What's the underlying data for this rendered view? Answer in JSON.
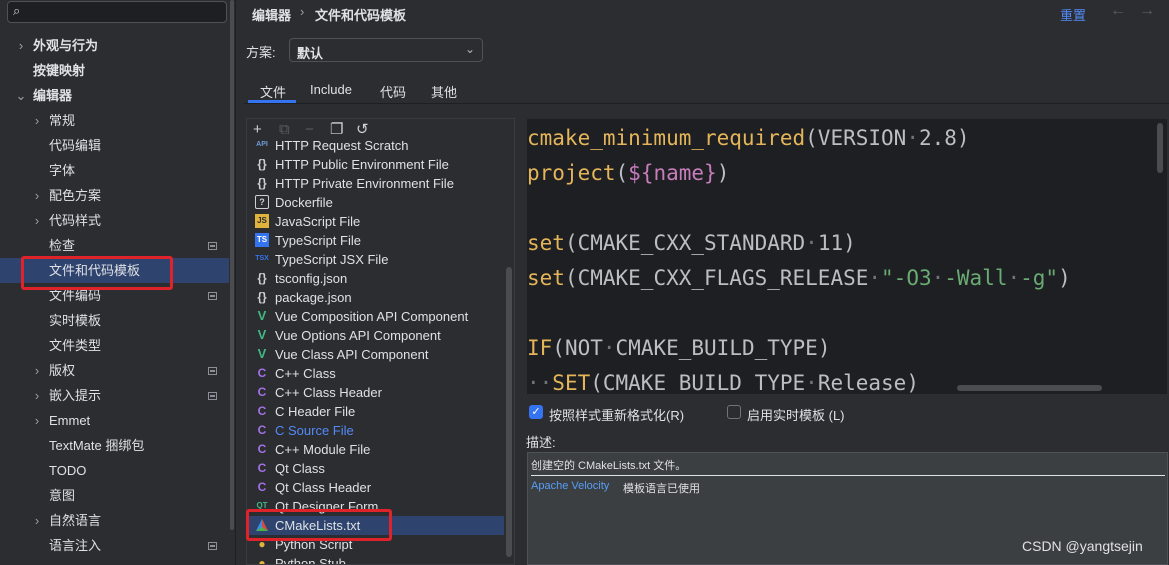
{
  "search": {
    "placeholder": "",
    "icon": "search-icon"
  },
  "sidebar": {
    "items": [
      {
        "label": "外观与行为",
        "chevron": "›",
        "bold": true
      },
      {
        "label": "按键映射",
        "chevron": "",
        "bold": true
      },
      {
        "label": "编辑器",
        "chevron": "⌄",
        "bold": true
      },
      {
        "label": "常规",
        "chevron": "›"
      },
      {
        "label": "代码编辑",
        "chevron": ""
      },
      {
        "label": "字体",
        "chevron": ""
      },
      {
        "label": "配色方案",
        "chevron": "›"
      },
      {
        "label": "代码样式",
        "chevron": "›"
      },
      {
        "label": "检查",
        "chevron": "",
        "mark": true
      },
      {
        "label": "文件和代码模板",
        "chevron": "",
        "selected": true
      },
      {
        "label": "文件编码",
        "chevron": "",
        "mark": true
      },
      {
        "label": "实时模板",
        "chevron": ""
      },
      {
        "label": "文件类型",
        "chevron": ""
      },
      {
        "label": "版权",
        "chevron": "›",
        "mark": true
      },
      {
        "label": "嵌入提示",
        "chevron": "›",
        "mark": true
      },
      {
        "label": "Emmet",
        "chevron": "›"
      },
      {
        "label": "TextMate 捆绑包",
        "chevron": ""
      },
      {
        "label": "TODO",
        "chevron": ""
      },
      {
        "label": "意图",
        "chevron": ""
      },
      {
        "label": "自然语言",
        "chevron": "›"
      },
      {
        "label": "语言注入",
        "chevron": "",
        "mark": true
      }
    ]
  },
  "header": {
    "breadcrumb_parent": "编辑器",
    "breadcrumb_sep": "›",
    "breadcrumb_current": "文件和代码模板",
    "reset_label": "重置",
    "back_icon": "←",
    "forward_icon": "→"
  },
  "scheme": {
    "label": "方案:",
    "value": "默认",
    "dropdown_icon": "⌄"
  },
  "tabs": [
    {
      "label": "文件",
      "active": true
    },
    {
      "label": "Include"
    },
    {
      "label": "代码"
    },
    {
      "label": "其他"
    }
  ],
  "toolbar": {
    "add_icon": "+",
    "copy_icon": "⧉",
    "remove_icon": "−",
    "duplicate_icon": "❐",
    "revert_icon": "↺"
  },
  "templates": [
    {
      "name": "HTTP Request Scratch",
      "icon": "API"
    },
    {
      "name": "HTTP Public Environment File",
      "icon": "{}"
    },
    {
      "name": "HTTP Private Environment File",
      "icon": "{}"
    },
    {
      "name": "Dockerfile",
      "icon": "?"
    },
    {
      "name": "JavaScript File",
      "icon": "JS"
    },
    {
      "name": "TypeScript File",
      "icon": "TS"
    },
    {
      "name": "TypeScript JSX File",
      "icon": "TSX"
    },
    {
      "name": "tsconfig.json",
      "icon": "{}"
    },
    {
      "name": "package.json",
      "icon": "{}"
    },
    {
      "name": "Vue Composition API Component",
      "icon": "V"
    },
    {
      "name": "Vue Options API Component",
      "icon": "V"
    },
    {
      "name": "Vue Class API Component",
      "icon": "V"
    },
    {
      "name": "C++ Class",
      "icon": "C"
    },
    {
      "name": "C++ Class Header",
      "icon": "C"
    },
    {
      "name": "C Header File",
      "icon": "C"
    },
    {
      "name": "C Source File",
      "icon": "C",
      "highlight": true
    },
    {
      "name": "C++ Module File",
      "icon": "C"
    },
    {
      "name": "Qt Class",
      "icon": "C"
    },
    {
      "name": "Qt Class Header",
      "icon": "C"
    },
    {
      "name": "Qt Designer Form",
      "icon": "QT"
    },
    {
      "name": "CMakeLists.txt",
      "icon": "▲",
      "selected": true
    },
    {
      "name": "Python Script",
      "icon": "●"
    },
    {
      "name": "Python Stub",
      "icon": "●"
    }
  ],
  "code": [
    {
      "segments": [
        {
          "t": "cmake_minimum_required",
          "c": "kw"
        },
        {
          "t": "(VERSION",
          "c": "tx"
        },
        {
          "t": "·",
          "c": "dt"
        },
        {
          "t": "2.8)",
          "c": "tx"
        }
      ]
    },
    {
      "segments": [
        {
          "t": "project",
          "c": "kw"
        },
        {
          "t": "(",
          "c": "tx"
        },
        {
          "t": "${name}",
          "c": "vr"
        },
        {
          "t": ")",
          "c": "tx"
        }
      ]
    },
    {
      "segments": []
    },
    {
      "segments": [
        {
          "t": "set",
          "c": "kw"
        },
        {
          "t": "(CMAKE_CXX_STANDARD",
          "c": "tx"
        },
        {
          "t": "·",
          "c": "dt"
        },
        {
          "t": "11)",
          "c": "tx"
        }
      ]
    },
    {
      "segments": [
        {
          "t": "set",
          "c": "kw"
        },
        {
          "t": "(CMAKE_CXX_FLAGS_RELEASE",
          "c": "tx"
        },
        {
          "t": "·",
          "c": "dt"
        },
        {
          "t": "\"-O3",
          "c": "st"
        },
        {
          "t": "·",
          "c": "dt"
        },
        {
          "t": "-Wall",
          "c": "st"
        },
        {
          "t": "·",
          "c": "dt"
        },
        {
          "t": "-g\"",
          "c": "st"
        },
        {
          "t": ")",
          "c": "tx"
        }
      ]
    },
    {
      "segments": []
    },
    {
      "segments": [
        {
          "t": "IF",
          "c": "kw"
        },
        {
          "t": "(NOT",
          "c": "tx"
        },
        {
          "t": "·",
          "c": "dt"
        },
        {
          "t": "CMAKE_BUILD_TYPE)",
          "c": "tx"
        }
      ]
    },
    {
      "segments": [
        {
          "t": "··",
          "c": "dt"
        },
        {
          "t": "SET",
          "c": "kw"
        },
        {
          "t": "(CMAKE_BUILD_TYPE",
          "c": "tx"
        },
        {
          "t": "·",
          "c": "dt"
        },
        {
          "t": "Release)",
          "c": "tx"
        }
      ]
    }
  ],
  "options": {
    "reformat_label": "按照样式重新格式化(R)",
    "reformat_checked": true,
    "live_template_label": "启用实时模板 (L)",
    "live_template_checked": false,
    "check_glyph": "✓"
  },
  "description": {
    "label": "描述:",
    "text": "创建空的 CMakeLists.txt 文件。",
    "link": "Apache Velocity",
    "rest": "模板语言已使用"
  },
  "watermark": "CSDN @yangtsejin",
  "colors": {
    "accent": "#3574f0",
    "selection": "#2e436e",
    "highlight_box": "#e0232a",
    "link": "#548af7"
  }
}
